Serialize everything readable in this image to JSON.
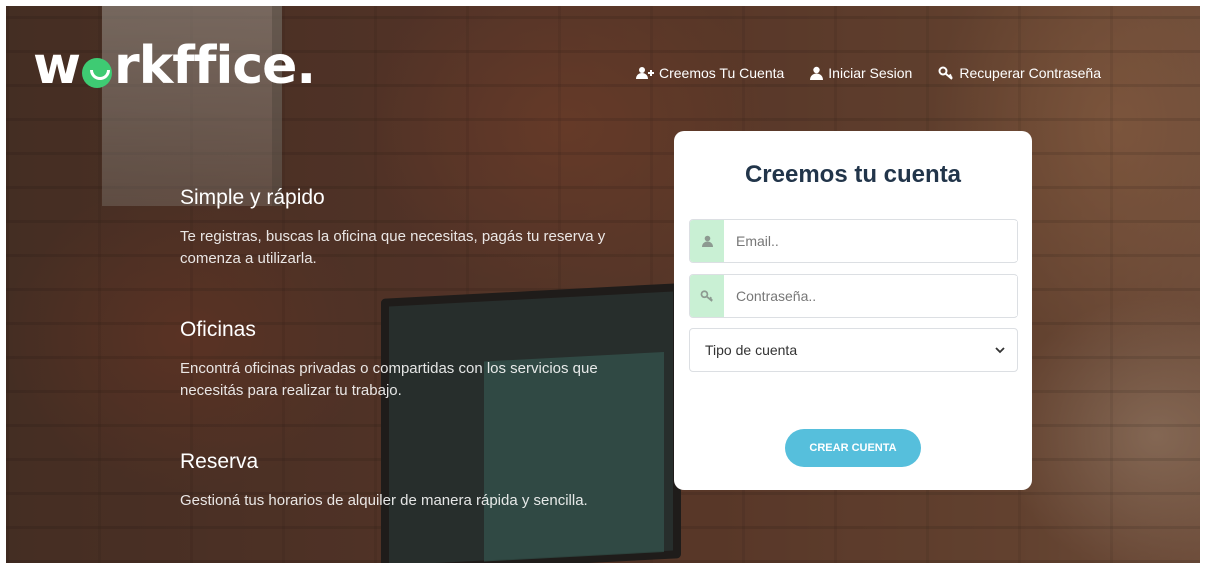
{
  "brand": {
    "logo_pre": "w",
    "logo_post": "rkffice.",
    "accent_color": "#3ecb73"
  },
  "nav": {
    "items": [
      {
        "label": "Creemos Tu Cuenta",
        "icon": "add-user-icon"
      },
      {
        "label": "Iniciar Sesion",
        "icon": "user-icon"
      },
      {
        "label": "Recuperar Contraseña",
        "icon": "key-icon"
      }
    ]
  },
  "features": [
    {
      "title": "Simple y rápido",
      "text": "Te registras, buscas la oficina que necesitas, pagás tu reserva y comenza a utilizarla."
    },
    {
      "title": "Oficinas",
      "text": "Encontrá oficinas privadas o compartidas con los servicios que necesitás para realizar tu trabajo."
    },
    {
      "title": "Reserva",
      "text": "Gestioná tus horarios de alquiler de manera rápida y sencilla."
    }
  ],
  "form": {
    "title": "Creemos tu cuenta",
    "email": {
      "placeholder": "Email..",
      "value": "",
      "icon": "user-icon"
    },
    "password": {
      "placeholder": "Contraseña..",
      "value": "",
      "icon": "key-icon"
    },
    "account_type": {
      "selected": "Tipo de cuenta",
      "icon": "chevron-down-icon"
    },
    "submit_label": "CREAR CUENTA",
    "addon_color": "#c9f0d4",
    "button_color": "#56bfdc"
  }
}
